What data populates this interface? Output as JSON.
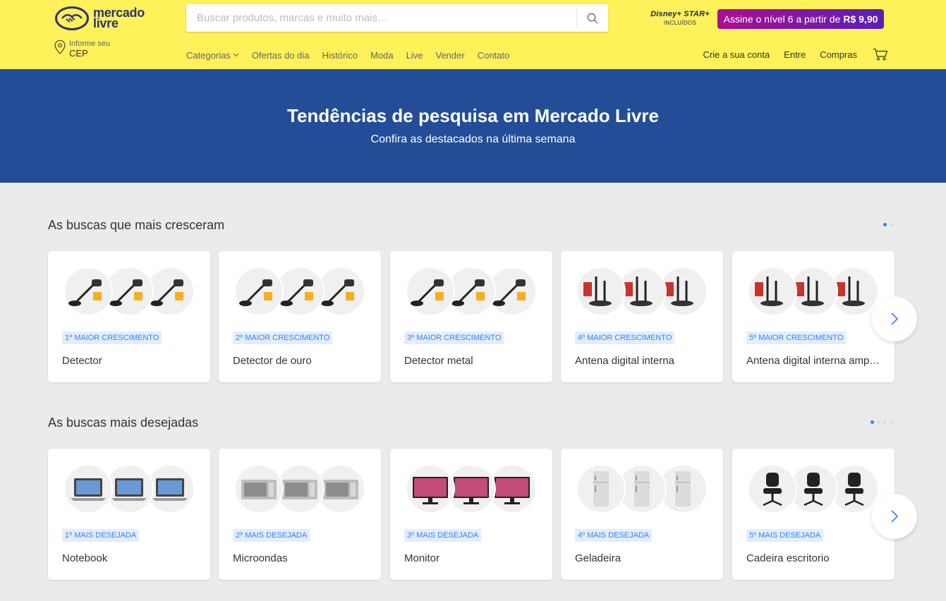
{
  "header": {
    "logo_line1": "mercado",
    "logo_line2": "livre",
    "search_placeholder": "Buscar produtos, marcas e muito mais…",
    "disney_brands": "Disney+ STAR+",
    "disney_included": "INCLUÍDOS",
    "promo_text": "Assine o nível 6 a partir de",
    "promo_price": "R$ 9,90",
    "cep_small": "Informe seu",
    "cep_big": "CEP",
    "nav": [
      "Categorias",
      "Ofertas do dia",
      "Histórico",
      "Moda",
      "Live",
      "Vender",
      "Contato"
    ],
    "account": [
      "Crie a sua conta",
      "Entre",
      "Compras"
    ]
  },
  "banner": {
    "title": "Tendências de pesquisa em Mercado Livre",
    "subtitle": "Confira as destacados na última semana"
  },
  "sections": [
    {
      "title": "As buscas que mais cresceram",
      "dots": 2,
      "active_dot": 0,
      "cards": [
        {
          "tag": "1º MAIOR CRESCIMENTO",
          "label": "Detector",
          "thumbs": [
            "detector",
            "detector",
            "detector"
          ]
        },
        {
          "tag": "2º MAIOR CRESCIMENTO",
          "label": "Detector de ouro",
          "thumbs": [
            "detector",
            "detector",
            "detector"
          ]
        },
        {
          "tag": "3º MAIOR CRESCIMENTO",
          "label": "Detector metal",
          "thumbs": [
            "detector",
            "detector",
            "detector"
          ]
        },
        {
          "tag": "4º MAIOR CRESCIMENTO",
          "label": "Antena digital interna",
          "thumbs": [
            "antenna",
            "antenna",
            "antenna"
          ]
        },
        {
          "tag": "5º MAIOR CRESCIMENTO",
          "label": "Antena digital interna amplificada",
          "thumbs": [
            "antenna",
            "antenna",
            "antenna"
          ]
        }
      ]
    },
    {
      "title": "As buscas mais desejadas",
      "dots": 4,
      "active_dot": 0,
      "cards": [
        {
          "tag": "1º MAIS DESEJADA",
          "label": "Notebook",
          "thumbs": [
            "laptop",
            "laptop",
            "laptop"
          ]
        },
        {
          "tag": "2º MAIS DESEJADA",
          "label": "Microondas",
          "thumbs": [
            "microwave",
            "microwave",
            "microwave"
          ]
        },
        {
          "tag": "3º MAIS DESEJADA",
          "label": "Monitor",
          "thumbs": [
            "monitor",
            "monitor",
            "monitor"
          ]
        },
        {
          "tag": "4º MAIS DESEJADA",
          "label": "Geladeira",
          "thumbs": [
            "fridge",
            "fridge",
            "fridge"
          ]
        },
        {
          "tag": "5º MAIS DESEJADA",
          "label": "Cadeira escritorio",
          "thumbs": [
            "chair",
            "chair",
            "chair"
          ]
        }
      ]
    }
  ],
  "colors": {
    "header_bg": "#fff159",
    "banner_bg": "#234d96",
    "accent": "#3483fa",
    "logo_blue": "#2d3277"
  },
  "icons": {
    "search": "search-icon",
    "location": "location-pin-icon",
    "cart": "cart-icon",
    "next": "chevron-right-icon"
  }
}
